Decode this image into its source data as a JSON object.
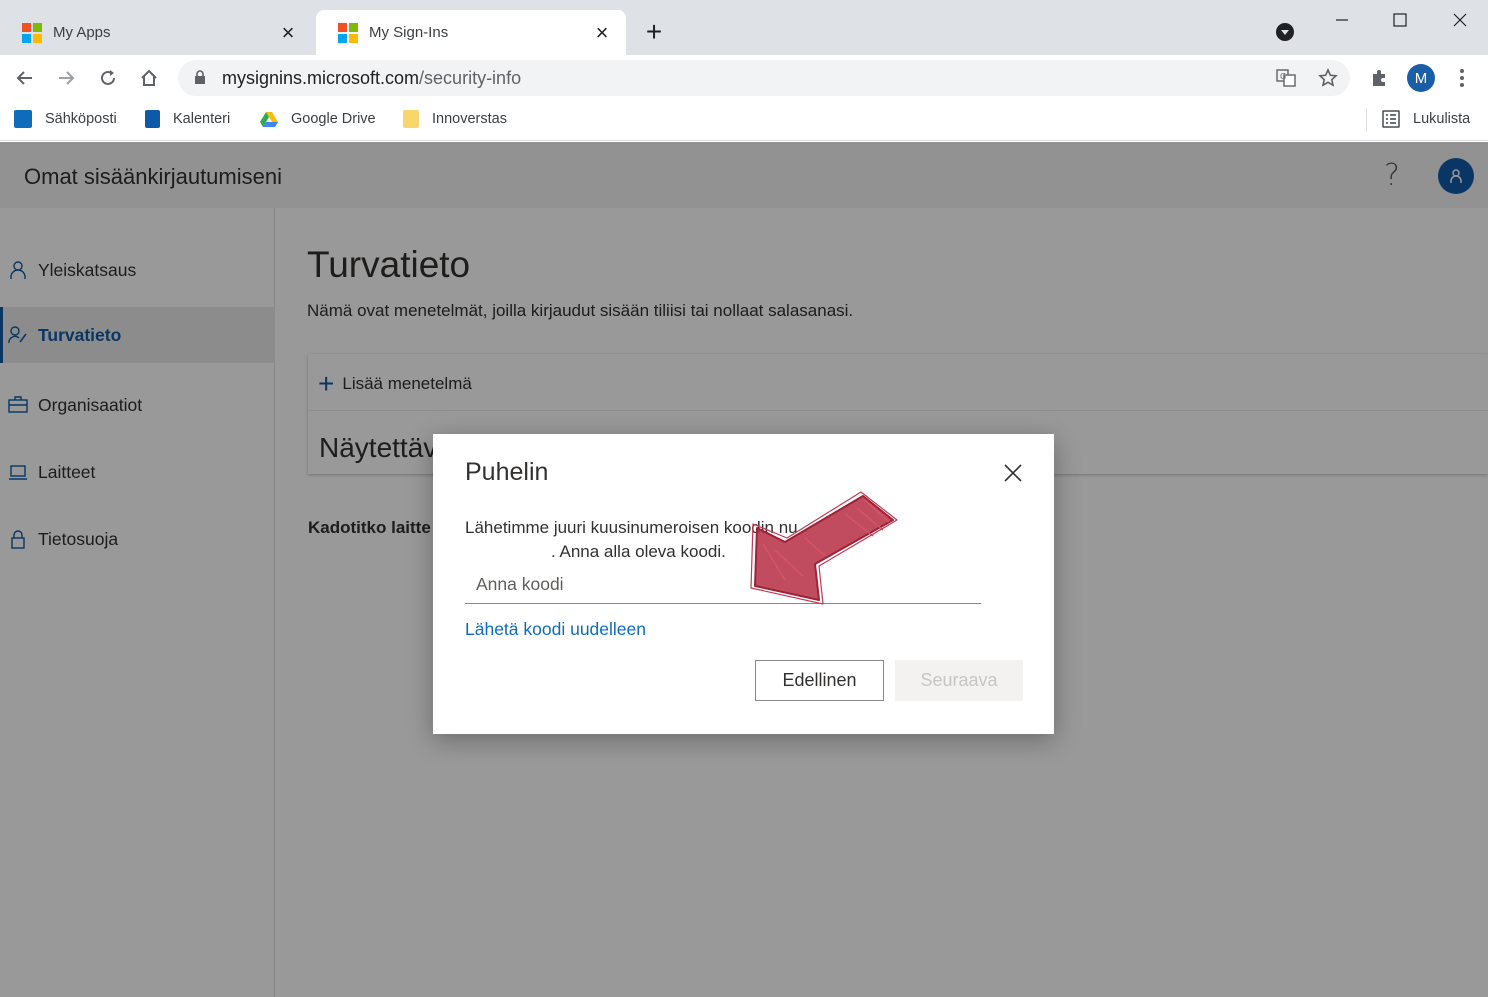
{
  "browser": {
    "tabs": [
      {
        "title": "My Apps",
        "active": false
      },
      {
        "title": "My Sign-Ins",
        "active": true
      }
    ],
    "url_domain": "mysignins.microsoft.com",
    "url_path": "/security-info",
    "profile_initial": "M",
    "bookmarks": [
      {
        "label": "Sähköposti",
        "icon": "outlook-icon",
        "color": "#0f6cbd"
      },
      {
        "label": "Kalenteri",
        "icon": "calendar-icon",
        "color": "#0f5aa8"
      },
      {
        "label": "Google Drive",
        "icon": "google-drive-icon",
        "color": "#34a853"
      },
      {
        "label": "Innoverstas",
        "icon": "folder-icon",
        "color": "#f9d56e"
      }
    ],
    "reading_list": "Lukulista"
  },
  "app": {
    "title": "Omat sisäänkirjautumiseni",
    "help_glyph": "?",
    "accent": "#0f5aa8"
  },
  "sidebar": {
    "items": [
      {
        "label": "Yleiskatsaus",
        "icon": "person-icon",
        "active": false
      },
      {
        "label": "Turvatieto",
        "icon": "security-info-icon",
        "active": true
      },
      {
        "label": "Organisaatiot",
        "icon": "briefcase-icon",
        "active": false
      },
      {
        "label": "Laitteet",
        "icon": "laptop-icon",
        "active": false
      },
      {
        "label": "Tietosuoja",
        "icon": "lock-icon",
        "active": false
      }
    ]
  },
  "main": {
    "heading": "Turvatieto",
    "subtitle": "Nämä ovat menetelmät, joilla kirjaudut sisään tiliisi tai nollaat salasanasi.",
    "add_method": "Lisää menetelmä",
    "card_heading": "Näytettäv",
    "lost_device": "Kadotitko laitte"
  },
  "dialog": {
    "title": "Puhelin",
    "text_line1": "Lähetimme juuri kuusinumeroisen koodin nu",
    "text_line2": ". Anna alla oleva koodi.",
    "code_placeholder": "Anna koodi",
    "resend_link": "Lähetä koodi uudelleen",
    "prev_button": "Edellinen",
    "next_button": "Seuraava"
  }
}
